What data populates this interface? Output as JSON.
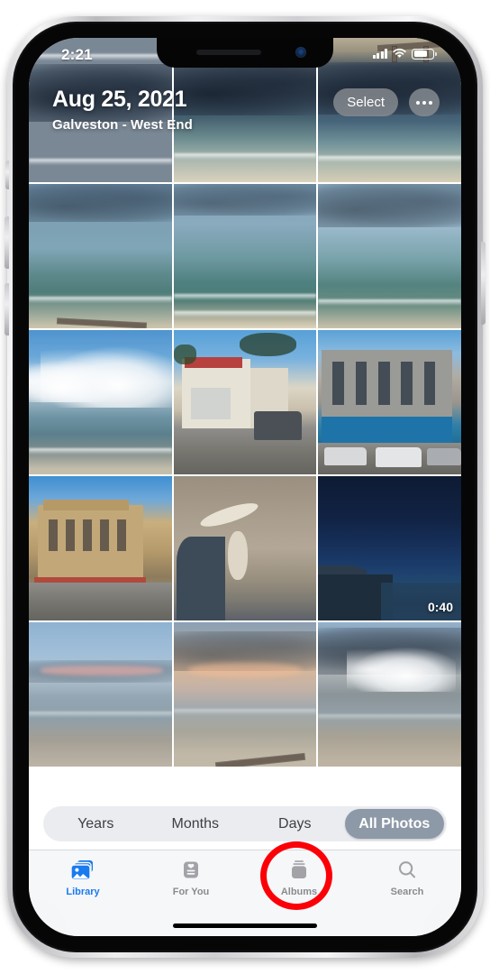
{
  "device": {
    "name": "iphone-frame"
  },
  "status_bar": {
    "time": "2:21",
    "icons": [
      "cellular-signal-icon",
      "wifi-icon",
      "battery-icon"
    ]
  },
  "header": {
    "date": "Aug 25, 2021",
    "subtitle": "Galveston - West End",
    "select_label": "Select",
    "more_label": "•••"
  },
  "photo_grid": {
    "columns": 3,
    "rows": 5,
    "cells": [
      {
        "id": "photo-1",
        "description": "beach surf with dark storm clouds"
      },
      {
        "id": "photo-2",
        "description": "sand and ocean under storm"
      },
      {
        "id": "photo-3",
        "description": "wooden pier with storm clouds"
      },
      {
        "id": "photo-4",
        "description": "rain squall over gulf beach"
      },
      {
        "id": "photo-5",
        "description": "teal ocean waves and shoreline"
      },
      {
        "id": "photo-6",
        "description": "dark storm front over sea"
      },
      {
        "id": "photo-7",
        "description": "blue sky cumulus clouds over beach"
      },
      {
        "id": "photo-8",
        "description": "historic theater street scene with truck"
      },
      {
        "id": "photo-9",
        "description": "blue storefront brick building with cars"
      },
      {
        "id": "photo-10",
        "description": "ornate victorian stone building corner"
      },
      {
        "id": "photo-11",
        "description": "fish skeleton on sand"
      },
      {
        "id": "photo-12",
        "description": "night seawall ocean video",
        "duration": "0:40",
        "is_video": true
      },
      {
        "id": "photo-13",
        "description": "dusk beach with pink clouds"
      },
      {
        "id": "photo-14",
        "description": "sunset over beach with pier"
      },
      {
        "id": "photo-15",
        "description": "dramatic clouds over shoreline"
      }
    ]
  },
  "segmented_control": {
    "options": [
      {
        "label": "Years",
        "selected": false
      },
      {
        "label": "Months",
        "selected": false
      },
      {
        "label": "Days",
        "selected": false
      },
      {
        "label": "All Photos",
        "selected": true
      }
    ]
  },
  "tab_bar": {
    "tabs": [
      {
        "label": "Library",
        "icon": "photo-library-icon",
        "active": true
      },
      {
        "label": "For You",
        "icon": "for-you-card-icon",
        "active": false
      },
      {
        "label": "Albums",
        "icon": "albums-stack-icon",
        "active": false
      },
      {
        "label": "Search",
        "icon": "search-icon",
        "active": false
      }
    ]
  },
  "annotation": {
    "type": "circle-highlight",
    "target": "Albums",
    "color": "#fb0007"
  },
  "colors": {
    "accent_blue": "#1a7aef",
    "inactive_gray": "#8b8b8f",
    "annotation_red": "#fb0007"
  }
}
